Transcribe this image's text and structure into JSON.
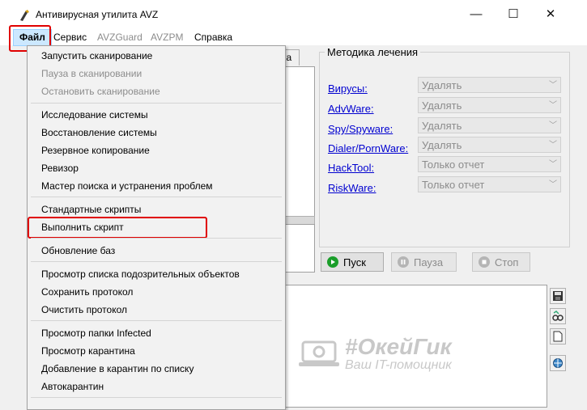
{
  "window": {
    "title": "Антивирусная утилита AVZ",
    "minimize_glyph": "—",
    "maximize_glyph": "☐",
    "close_glyph": "✕"
  },
  "menubar": {
    "items": [
      "Файл",
      "Сервис",
      "AVZGuard",
      "AVZPM",
      "Справка"
    ]
  },
  "file_menu": {
    "groups": [
      {
        "items": [
          {
            "label": "Запустить сканирование",
            "enabled": true
          },
          {
            "label": "Пауза в сканировании",
            "enabled": false
          },
          {
            "label": "Остановить сканирование",
            "enabled": false
          }
        ]
      },
      {
        "items": [
          {
            "label": "Исследование системы",
            "enabled": true
          },
          {
            "label": "Восстановление системы",
            "enabled": true
          },
          {
            "label": "Резервное копирование",
            "enabled": true
          },
          {
            "label": "Ревизор",
            "enabled": true
          },
          {
            "label": "Мастер поиска и устранения проблем",
            "enabled": true
          }
        ]
      },
      {
        "items": [
          {
            "label": "Стандартные скрипты",
            "enabled": true
          },
          {
            "label": "Выполнить скрипт",
            "enabled": true
          }
        ]
      },
      {
        "items": [
          {
            "label": "Обновление баз",
            "enabled": true
          }
        ]
      },
      {
        "items": [
          {
            "label": "Просмотр списка подозрительных объектов",
            "enabled": true
          },
          {
            "label": "Сохранить протокол",
            "enabled": true
          },
          {
            "label": "Очистить протокол",
            "enabled": true
          }
        ]
      },
      {
        "items": [
          {
            "label": "Просмотр папки Infected",
            "enabled": true
          },
          {
            "label": "Просмотр карантина",
            "enabled": true
          },
          {
            "label": "Добавление в карантин по списку",
            "enabled": true
          },
          {
            "label": "Автокарантин",
            "enabled": true
          }
        ]
      }
    ]
  },
  "treatment": {
    "title": "Методика лечения",
    "rows": [
      {
        "threat": "Вирусы:",
        "action": "Удалять"
      },
      {
        "threat": "AdvWare:",
        "action": "Удалять"
      },
      {
        "threat": "Spy/Spyware:",
        "action": "Удалять"
      },
      {
        "threat": "Dialer/PornWare:",
        "action": "Удалять"
      },
      {
        "threat": "HackTool:",
        "action": "Только отчет"
      },
      {
        "threat": "RiskWare:",
        "action": "Только отчет"
      }
    ]
  },
  "controls": {
    "start_label": "Пуск",
    "pause_label": "Пауза",
    "stop_label": "Стоп"
  },
  "tab_partial": "ка",
  "watermark": {
    "title": "#ОкейГик",
    "subtitle": "Ваш IT-помощник"
  },
  "colors": {
    "highlight_red": "#e00000",
    "link_blue": "#0000d0",
    "start_green": "#1a9e2a"
  }
}
